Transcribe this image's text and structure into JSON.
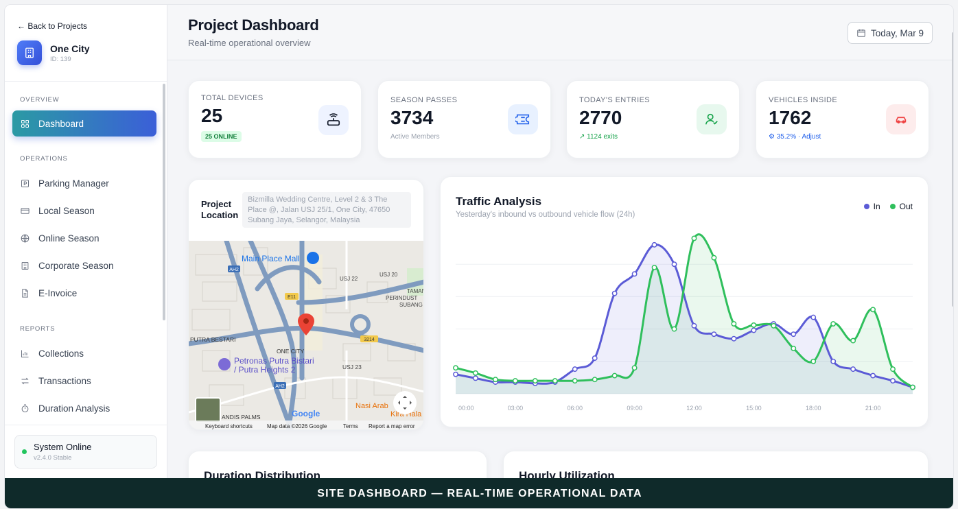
{
  "sidebar": {
    "back_label": "← Back to Projects",
    "project_name": "One City",
    "project_id": "ID: 139",
    "sections": {
      "overview": "OVERVIEW",
      "operations": "OPERATIONS",
      "reports": "REPORTS"
    },
    "items": {
      "dashboard": "Dashboard",
      "parking_manager": "Parking Manager",
      "local_season": "Local Season",
      "online_season": "Online Season",
      "corporate_season": "Corporate Season",
      "e_invoice": "E-Invoice",
      "collections": "Collections",
      "transactions": "Transactions",
      "duration_analysis": "Duration Analysis"
    },
    "status": {
      "title": "System Online",
      "version": "v2.4.0 Stable"
    }
  },
  "header": {
    "title": "Project Dashboard",
    "subtitle": "Real-time operational overview",
    "date_label": "Today, Mar 9"
  },
  "stats": [
    {
      "label": "TOTAL DEVICES",
      "value": "25",
      "sub": "25 ONLINE",
      "icon": "router-icon",
      "accent": "#2563eb"
    },
    {
      "label": "SEASON PASSES",
      "value": "3734",
      "sub": "Active Members",
      "icon": "ticket-icon",
      "accent": "#2563eb"
    },
    {
      "label": "TODAY'S ENTRIES",
      "value": "2770",
      "sub": "↗ 1124 exits",
      "icon": "user-check-icon",
      "accent": "#16a34a"
    },
    {
      "label": "VEHICLES INSIDE",
      "value": "1762",
      "sub": "35.2% · Adjust",
      "icon": "car-icon",
      "accent": "#ef4444"
    }
  ],
  "location": {
    "label_line1": "Project",
    "label_line2": "Location",
    "address": "Bizmilla Wedding Centre, Level 2 & 3 The Place @, Jalan USJ 25/1, One City, 47650 Subang Jaya, Selangor, Malaysia",
    "map_labels": {
      "mall": "Main Place Mall",
      "usj22": "USJ 22",
      "usj20": "USJ 20",
      "taman": "TAMAN",
      "perindust": "PERINDUST",
      "subang": "SUBANG",
      "putra": "PUTRA BESTARI",
      "onecity": "ONE CITY",
      "petronas1": "Petronas Putra Bistari",
      "petronas2": "/ Putra Heights 2",
      "usj23": "USJ 23",
      "nasi": "Nasi Arab",
      "kira": "Kira Hala",
      "palms": "ANDIS PALMS",
      "google": "Google",
      "ah2": "AH2",
      "e11": "E11",
      "r3214": "3214"
    },
    "map_footer": {
      "shortcuts": "Keyboard shortcuts",
      "data": "Map data ©2026 Google",
      "terms": "Terms",
      "report": "Report a map error"
    }
  },
  "traffic": {
    "title": "Traffic Analysis",
    "subtitle": "Yesterday's inbound vs outbound vehicle flow (24h)",
    "legend_in": "In",
    "legend_out": "Out",
    "color_in": "#5b5bd6",
    "color_out": "#2fbf5c"
  },
  "chart_data": {
    "type": "line",
    "title": "Traffic Analysis",
    "x": [
      "00:00",
      "01:00",
      "02:00",
      "03:00",
      "04:00",
      "05:00",
      "06:00",
      "07:00",
      "08:00",
      "09:00",
      "10:00",
      "11:00",
      "12:00",
      "13:00",
      "14:00",
      "15:00",
      "16:00",
      "17:00",
      "18:00",
      "19:00",
      "20:00",
      "21:00",
      "22:00",
      "23:00"
    ],
    "tick_labels": [
      "00:00",
      "03:00",
      "06:00",
      "09:00",
      "12:00",
      "15:00",
      "18:00",
      "21:00"
    ],
    "series": [
      {
        "name": "In",
        "values": [
          30,
          24,
          18,
          18,
          16,
          18,
          38,
          55,
          155,
          185,
          230,
          200,
          105,
          92,
          85,
          98,
          108,
          92,
          118,
          50,
          38,
          28,
          20,
          10
        ]
      },
      {
        "name": "Out",
        "values": [
          40,
          32,
          22,
          20,
          20,
          20,
          20,
          22,
          28,
          40,
          195,
          100,
          240,
          210,
          108,
          106,
          105,
          70,
          50,
          108,
          82,
          130,
          38,
          10
        ]
      }
    ],
    "ylim": [
      0,
      250
    ],
    "grid": true,
    "legend": "top-right"
  },
  "bottom_cards": {
    "duration": "Duration Distribution",
    "hourly": "Hourly Utilization"
  },
  "footer": "SITE DASHBOARD — REAL-TIME OPERATIONAL DATA"
}
